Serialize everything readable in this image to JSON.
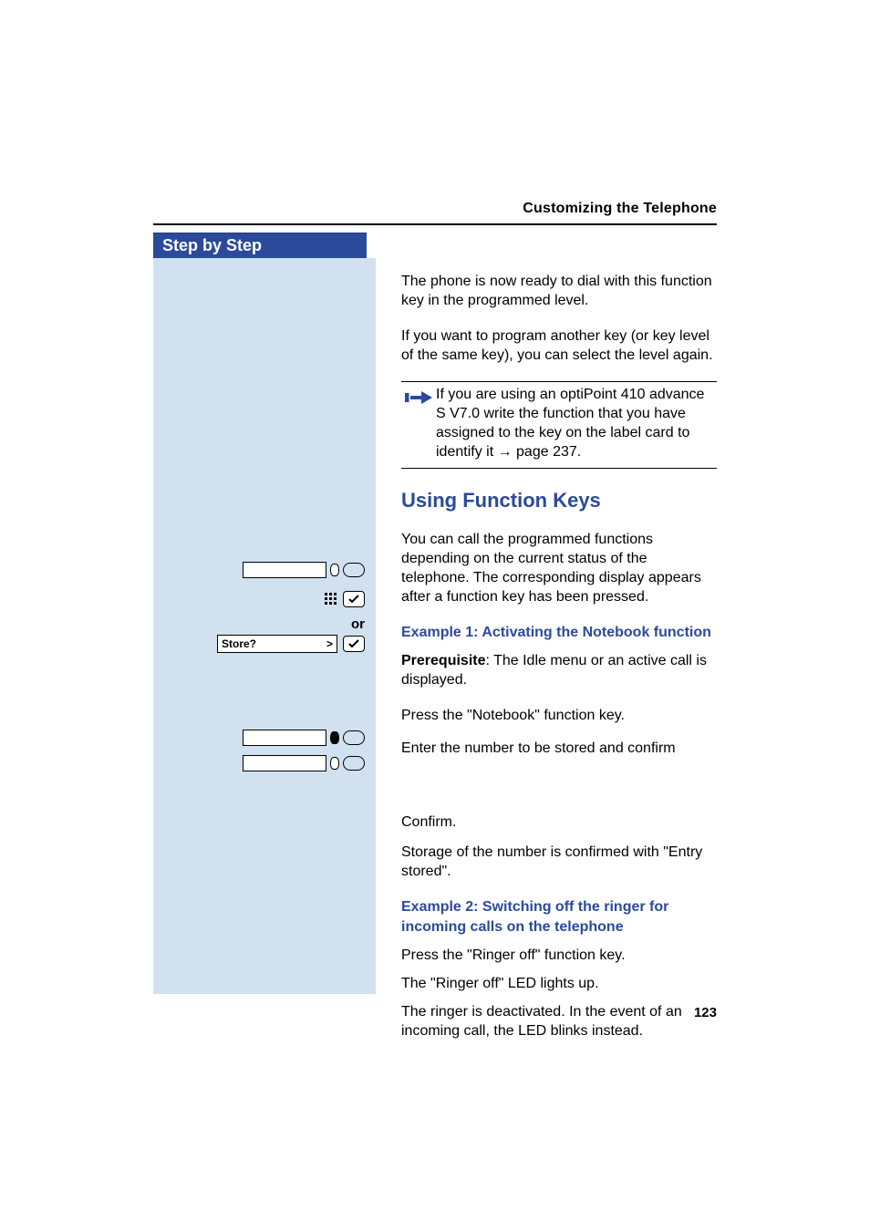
{
  "header": {
    "running_head": "Customizing the Telephone",
    "step_bar": "Step by Step"
  },
  "content": {
    "p1": "The phone is now ready to dial with this function key in the programmed level.",
    "p2": "If you want to program another key (or key level of the same key), you can select the level again.",
    "note": "If you are using an optiPoint 410 advance S V7.0 write the function that you have assigned to the key on the label card to identify it → page 237.",
    "h2": "Using Function Keys",
    "p3": "You can call the programmed functions depending on the current status of the telephone. The corresponding display appears after a function key has been pressed.",
    "ex1_title": "Example 1: Activating the Notebook function",
    "ex1_prereq_label": "Prerequisite",
    "ex1_prereq_rest": ": The Idle menu or an active call is displayed.",
    "ex1_s1": "Press the \"Notebook\" function key.",
    "ex1_s2": "Enter the number to be stored and confirm",
    "or": "or",
    "store_display": "Store?",
    "store_chev": ">",
    "ex1_s3": "Confirm.",
    "ex1_s4": "Storage of the number is confirmed with \"Entry stored\".",
    "ex2_title": "Example 2: Switching off the ringer for incoming calls on the telephone",
    "ex2_s1": "Press the \"Ringer off\" function key.",
    "ex2_s2": "The \"Ringer off\" LED lights up.",
    "ex2_s3": "The ringer is deactivated. In the event of an incoming call, the LED blinks instead."
  },
  "footer": {
    "page": "123"
  }
}
